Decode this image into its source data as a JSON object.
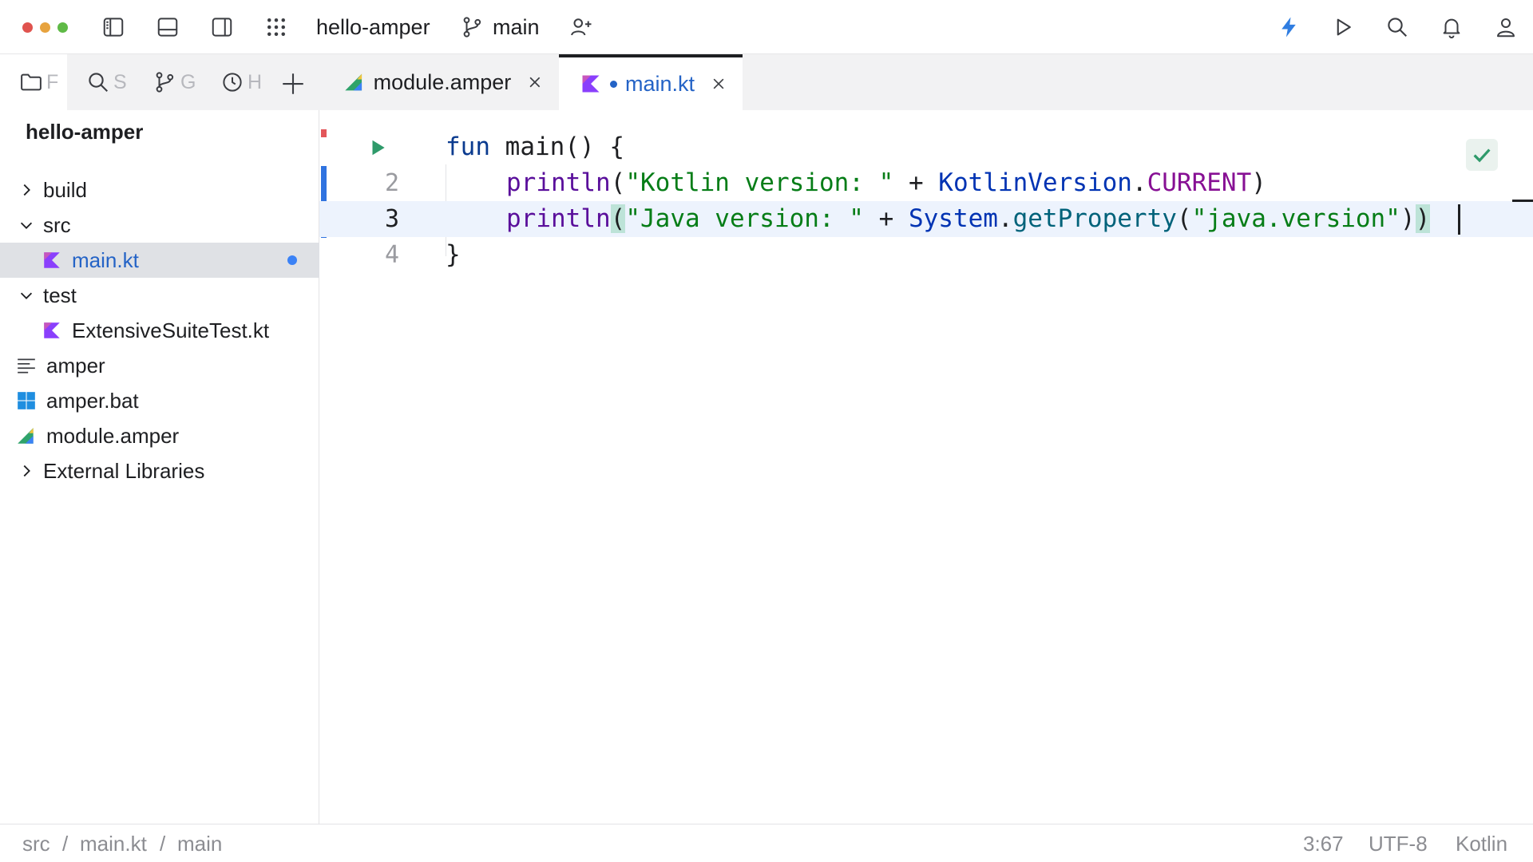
{
  "titlebar": {
    "project": "hello-amper",
    "branch": "main",
    "icons": [
      "sidebar-left-icon",
      "panel-bottom-icon",
      "sidebar-right-icon",
      "apps-grid-icon",
      "branch-icon",
      "add-user-icon",
      "lightning-icon",
      "run-icon",
      "search-icon",
      "bell-icon",
      "user-icon"
    ],
    "accent": "#2f7de1",
    "traffic_lights": [
      "#e0534e",
      "#e7a33e",
      "#5fba46"
    ]
  },
  "side_tabs": [
    {
      "icon": "folder-icon",
      "letter": "F"
    },
    {
      "icon": "search-icon",
      "letter": "S"
    },
    {
      "icon": "branch-icon",
      "letter": "G"
    },
    {
      "icon": "clock-icon",
      "letter": "H"
    }
  ],
  "project_tree": {
    "title": "hello-amper",
    "items": [
      {
        "label": "build",
        "icon": "chevron-right-icon"
      },
      {
        "label": "src",
        "icon": "chevron-down-icon"
      },
      {
        "label": "main.kt",
        "icon": "kotlin-file-icon",
        "selected": true,
        "modified": true
      },
      {
        "label": "test",
        "icon": "chevron-down-icon"
      },
      {
        "label": "ExtensiveSuiteTest.kt",
        "icon": "kotlin-file-icon"
      },
      {
        "label": "amper",
        "icon": "text-file-icon"
      },
      {
        "label": "amper.bat",
        "icon": "windows-icon"
      },
      {
        "label": "module.amper",
        "icon": "amper-icon"
      },
      {
        "label": "External Libraries",
        "icon": "chevron-right-icon"
      }
    ]
  },
  "editor_tabs": [
    {
      "label": "module.amper",
      "icon": "amper-icon",
      "active": false
    },
    {
      "label": "main.kt",
      "icon": "kotlin-file-icon",
      "active": true,
      "modified": true
    }
  ],
  "code": {
    "line_numbers": [
      "2",
      "3",
      "4"
    ],
    "line1": {
      "kw": "fun",
      "name": "main",
      "rest": "() {"
    },
    "line2": {
      "call": "println",
      "open": "(",
      "str": "\"Kotlin version: \"",
      "plus": " + ",
      "cls": "KotlinVersion",
      "dot": ".",
      "prop": "CURRENT",
      "close": ")"
    },
    "line3": {
      "call": "println",
      "open": "(",
      "str": "\"Java version: \"",
      "plus": " + ",
      "cls": "System",
      "dot": ".",
      "method": "getProperty",
      "open2": "(",
      "str2": "\"java.version\"",
      "close2": ")",
      "close": ")"
    },
    "line4": {
      "text": "}"
    }
  },
  "statusbar": {
    "breadcrumb": [
      "src",
      "main.kt",
      "main"
    ],
    "separator": "/",
    "position": "3:67",
    "encoding": "UTF-8",
    "language": "Kotlin"
  }
}
